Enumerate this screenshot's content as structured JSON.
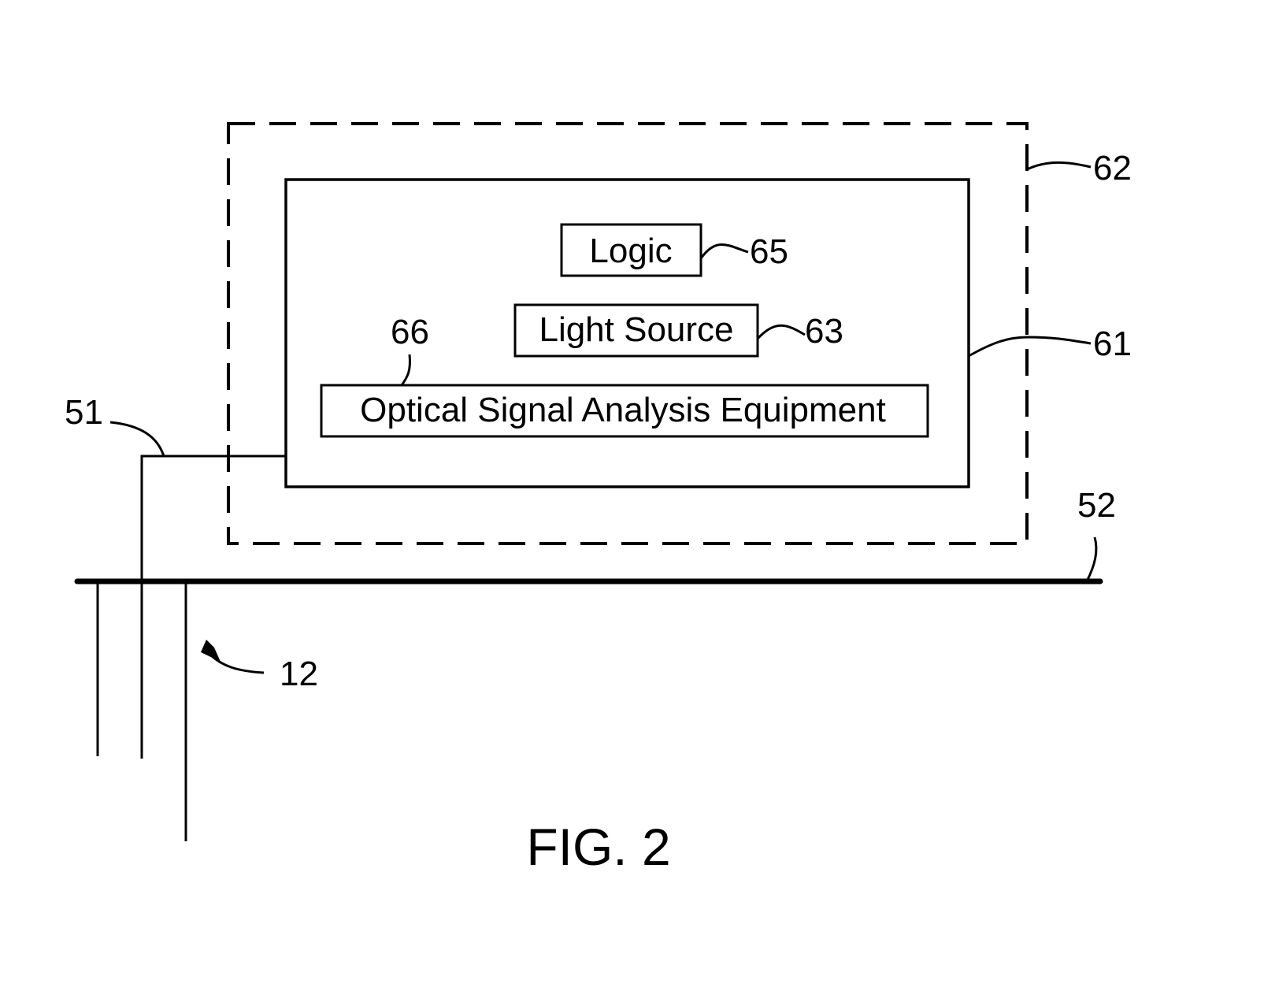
{
  "figure": {
    "caption": "FIG. 2"
  },
  "colors": {
    "ink": "#000000",
    "background": "#ffffff"
  },
  "components": {
    "enclosure": {
      "ref": "62",
      "style": "dashed"
    },
    "unit": {
      "ref": "61"
    },
    "logic": {
      "label": "Logic",
      "ref": "65"
    },
    "light_source": {
      "label": "Light Source",
      "ref": "63"
    },
    "analysis_equipment": {
      "label": "Optical Signal Analysis Equipment",
      "ref": "66"
    },
    "fiber": {
      "ref": "51"
    },
    "bus": {
      "ref": "52"
    },
    "cable_bundle": {
      "ref": "12"
    }
  }
}
